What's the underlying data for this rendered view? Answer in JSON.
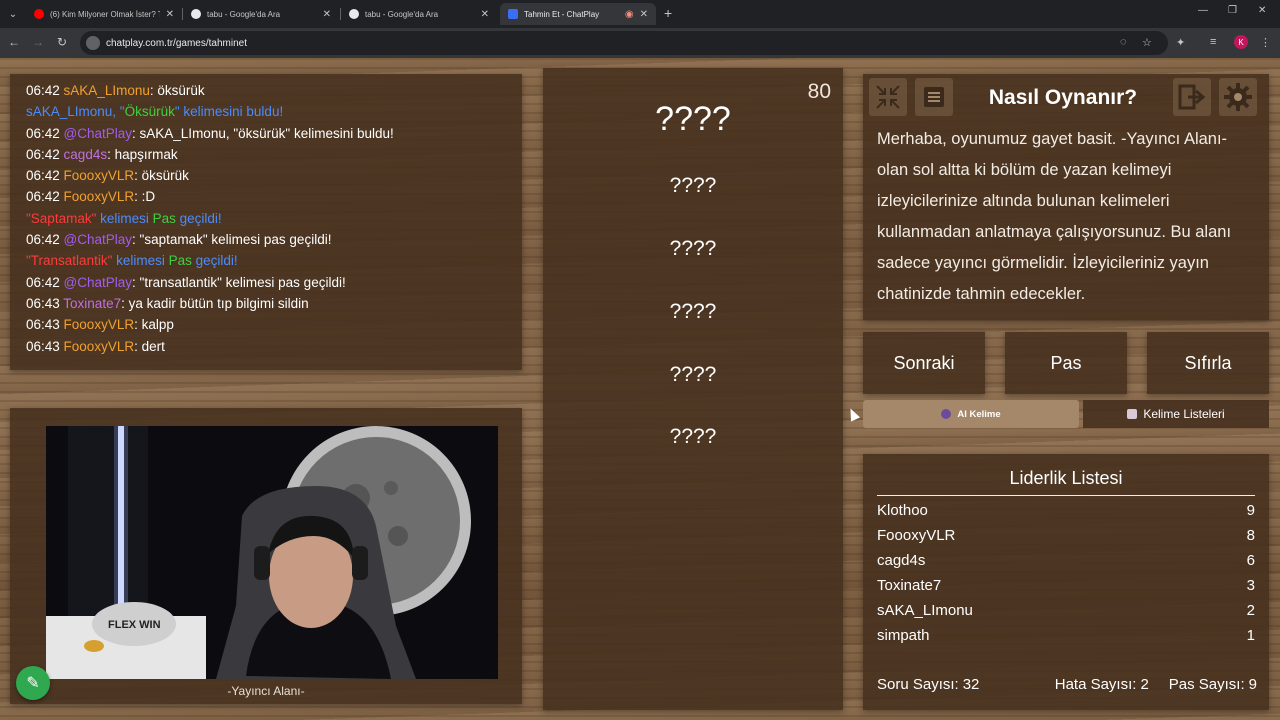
{
  "browser": {
    "tabs": [
      {
        "label": "(6) Kim Milyoner Olmak İster? T",
        "favicon_color": "#ff0000"
      },
      {
        "label": "tabu - Google'da Ara",
        "favicon_color": "#4285f4"
      },
      {
        "label": "tabu - Google'da Ara",
        "favicon_color": "#4285f4"
      },
      {
        "label": "Tahmin Et - ChatPlay",
        "favicon_color": "#3b6ef5"
      }
    ],
    "url": "chatplay.com.tr/games/tahminet",
    "profile_initial": "K"
  },
  "chat": {
    "messages": [
      {
        "time": "06:42",
        "user": "sAKA_LImonu",
        "user_color": "orange",
        "text": ": öksürük"
      },
      {
        "time": "",
        "system": [
          {
            "t": "sAKA_LImonu, \"",
            "c": "blue"
          },
          {
            "t": "Öksürük",
            "c": "green"
          },
          {
            "t": "\" kelimesini buldu!",
            "c": "blue"
          }
        ]
      },
      {
        "time": "06:42",
        "user": "@ChatPlay",
        "user_color": "purple",
        "text": ": sAKA_LImonu, \"öksürük\" kelimesini buldu!"
      },
      {
        "time": "06:42",
        "user": "cagd4s",
        "user_color": "pink",
        "text": ": hapşırmak"
      },
      {
        "time": "06:42",
        "user": "FoooxyVLR",
        "user_color": "orange",
        "text": ": öksürük"
      },
      {
        "time": "06:42",
        "user": "FoooxyVLR",
        "user_color": "orange",
        "text": ": :D"
      },
      {
        "time": "",
        "system": [
          {
            "t": "\"Saptamak\"",
            "c": "red"
          },
          {
            "t": " kelimesi ",
            "c": "blue"
          },
          {
            "t": "Pas",
            "c": "green"
          },
          {
            "t": " geçildi!",
            "c": "blue"
          }
        ]
      },
      {
        "time": "06:42",
        "user": "@ChatPlay",
        "user_color": "purple",
        "text": ": \"saptamak\" kelimesi pas geçildi!"
      },
      {
        "time": "",
        "system": [
          {
            "t": "\"Transatlantik\"",
            "c": "red"
          },
          {
            "t": " kelimesi ",
            "c": "blue"
          },
          {
            "t": "Pas",
            "c": "green"
          },
          {
            "t": " geçildi!",
            "c": "blue"
          }
        ]
      },
      {
        "time": "06:42",
        "user": "@ChatPlay",
        "user_color": "purple",
        "text": ": \"transatlantik\" kelimesi pas geçildi!"
      },
      {
        "time": "06:43",
        "user": "Toxinate7",
        "user_color": "pink",
        "text": ": ya kadir bütün tıp bilgimi sildin"
      },
      {
        "time": "06:43",
        "user": "FoooxyVLR",
        "user_color": "orange",
        "text": ": kalpp"
      },
      {
        "time": "06:43",
        "user": "FoooxyVLR",
        "user_color": "orange",
        "text": ": dert"
      }
    ]
  },
  "stream": {
    "label": "-Yayıncı Alanı-",
    "pillow_text": "FLEX WIN"
  },
  "words": {
    "score": "80",
    "main": "????",
    "forbidden": [
      "????",
      "????",
      "????",
      "????",
      "????"
    ]
  },
  "howto": {
    "title": "Nasıl Oynanır?",
    "text": "Merhaba, oyunumuz gayet basit. -Yayıncı Alanı- olan sol altta ki bölüm de yazan kelimeyi izleyicilerinize altında bulunan kelimeleri kullanmadan anlatmaya çalışıyorsunuz. Bu alanı sadece yayıncı görmelidir. İzleyicileriniz yayın chatinizde tahmin edecekler."
  },
  "controls": {
    "next": "Sonraki",
    "pass": "Pas",
    "reset": "Sıfırla",
    "ai_word": "AI Kelime",
    "word_lists": "Kelime Listeleri"
  },
  "leaderboard": {
    "title": "Liderlik Listesi",
    "rows": [
      {
        "name": "Klothoo",
        "score": "9"
      },
      {
        "name": "FoooxyVLR",
        "score": "8"
      },
      {
        "name": "cagd4s",
        "score": "6"
      },
      {
        "name": "Toxinate7",
        "score": "3"
      },
      {
        "name": "sAKA_LImonu",
        "score": "2"
      },
      {
        "name": "simpath",
        "score": "1"
      }
    ]
  },
  "stats": {
    "questions_label": "Soru Sayısı:",
    "questions": "32",
    "errors_label": "Hata Sayısı:",
    "errors": "2",
    "passes_label": "Pas Sayısı:",
    "passes": "9"
  },
  "colors": {
    "orange": "#f0a030",
    "blue": "#4a8cff",
    "purple": "#a45cf0",
    "green": "#3fcf3f",
    "red": "#ff3a3a",
    "pink": "#c070e0"
  }
}
